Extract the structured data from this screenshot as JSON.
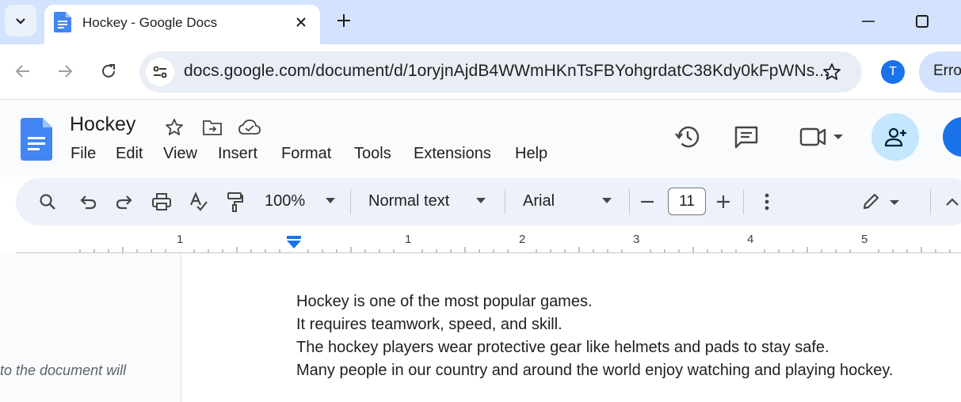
{
  "browser": {
    "tab": {
      "title": "Hockey - Google Docs"
    },
    "address_bar": {
      "url": "docs.google.com/document/d/1oryjnAjdB4WWmHKnTsFBYohgrdatC38Kdy0kFpWNs..."
    },
    "profile_initial": "T",
    "error_chip": "Error"
  },
  "docs": {
    "title": "Hockey",
    "menu": [
      "File",
      "Edit",
      "View",
      "Insert",
      "Format",
      "Tools",
      "Extensions",
      "Help"
    ],
    "toolbar": {
      "zoom": "100%",
      "style": "Normal text",
      "font": "Arial",
      "font_size": "11"
    },
    "ruler": {
      "labels": [
        "1",
        "1",
        "2",
        "3",
        "4",
        "5"
      ]
    },
    "content": [
      "Hockey is one of the most popular games.",
      "It requires teamwork, speed, and skill.",
      "The hockey players wear protective gear like helmets and pads to stay safe.",
      "Many people in our country and around the world enjoy watching and playing hockey."
    ],
    "side_note": "to the document will"
  },
  "colors": {
    "tab_strip": "#d3e3fd",
    "docs_blue": "#4285f4",
    "share_button": "#c2e7ff",
    "toolbar_bg": "#edf2fa",
    "ruler_indent": "#1a73e8"
  },
  "icons": [
    "tab-search-icon",
    "docs-favicon-icon",
    "close-icon",
    "plus-icon",
    "minimize-icon",
    "maximize-icon",
    "back-icon",
    "forward-icon",
    "reload-icon",
    "site-info-icon",
    "bookmark-star-icon",
    "star-icon",
    "move-folder-icon",
    "cloud-saved-icon",
    "history-icon",
    "comment-icon",
    "video-call-icon",
    "add-person-icon",
    "search-icon",
    "undo-icon",
    "redo-icon",
    "print-icon",
    "spellcheck-icon",
    "paint-format-icon",
    "minus-icon",
    "more-vert-icon",
    "pencil-icon",
    "chevron-up-icon"
  ]
}
